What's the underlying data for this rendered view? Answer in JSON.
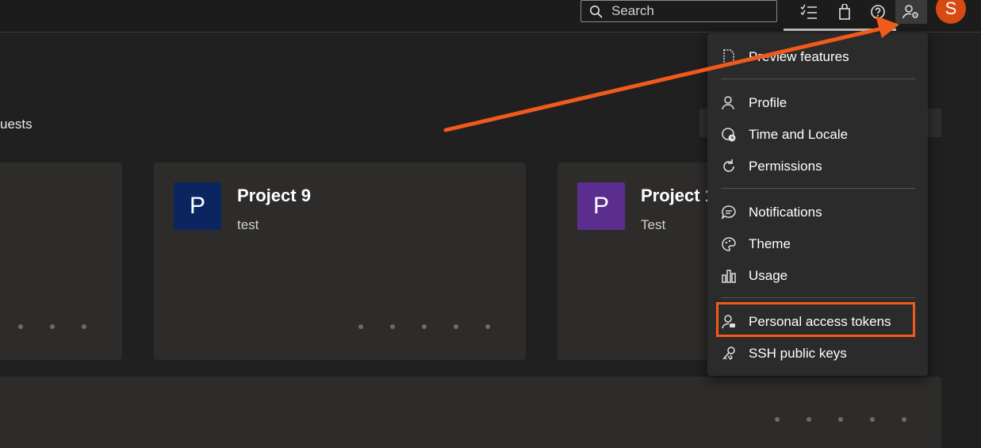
{
  "search": {
    "placeholder": "Search"
  },
  "toolbar": {
    "icons": [
      "task-list-icon",
      "shopping-bag-icon",
      "help-icon",
      "user-settings-icon"
    ],
    "avatar_letter": "S"
  },
  "tab_partial": "uests",
  "projects": [
    {
      "name": "Project 9",
      "description": "test",
      "avatar_letter": "P",
      "color": "#0b2560"
    },
    {
      "name": "Project 1",
      "description": "Test",
      "avatar_letter": "P",
      "color": "#5b2d8e"
    }
  ],
  "menu": {
    "items": [
      {
        "label": "Preview features",
        "icon": "document-icon"
      },
      {
        "label": "Profile",
        "icon": "profile-icon"
      },
      {
        "label": "Time and Locale",
        "icon": "globe-clock-icon"
      },
      {
        "label": "Permissions",
        "icon": "refresh-icon"
      },
      {
        "label": "Notifications",
        "icon": "chat-bubble-icon"
      },
      {
        "label": "Theme",
        "icon": "palette-icon"
      },
      {
        "label": "Usage",
        "icon": "bar-chart-icon"
      },
      {
        "label": "Personal access tokens",
        "icon": "person-key-icon"
      },
      {
        "label": "SSH public keys",
        "icon": "keys-icon"
      }
    ]
  },
  "colors": {
    "accent": "#f05a1a",
    "avatar_bg": "#d74a12",
    "background": "#202020"
  }
}
